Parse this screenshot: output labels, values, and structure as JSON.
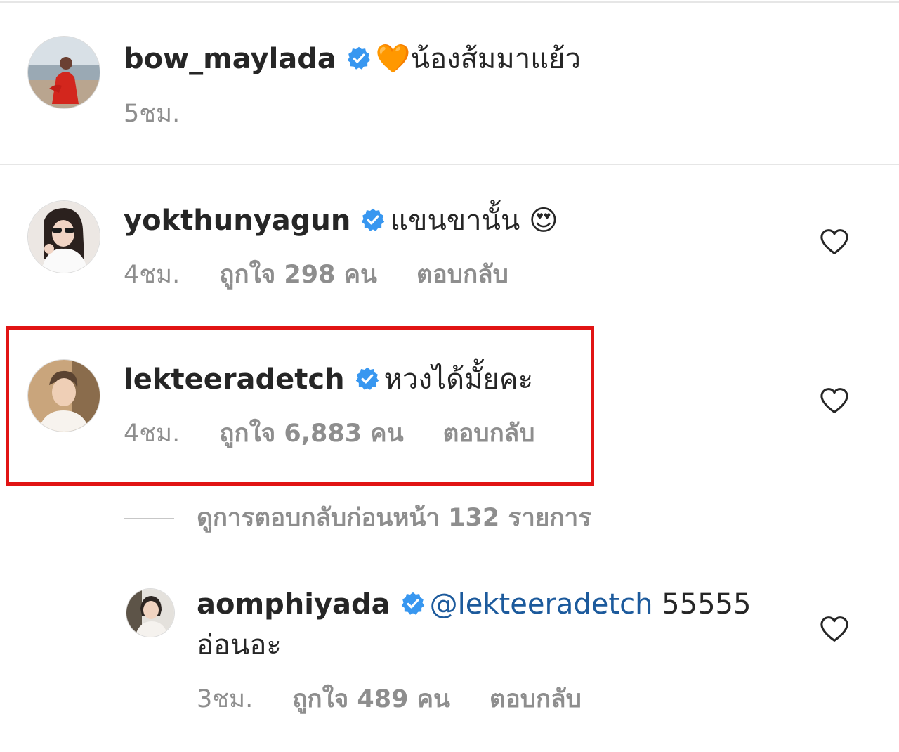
{
  "caption": {
    "username": "bow_maylada",
    "emoji": "🧡",
    "text": "น้องส้มมาแย้ว",
    "time": "5ชม."
  },
  "comments": [
    {
      "username": "yokthunyagun",
      "text": "แขนขานั้น",
      "emoji": "😍",
      "time": "4ชม.",
      "likes": "ถูกใจ 298 คน",
      "reply": "ตอบกลับ"
    },
    {
      "username": "lekteeradetch",
      "text": "หวงได้มั้ยคะ",
      "time": "4ชม.",
      "likes": "ถูกใจ 6,883 คน",
      "reply": "ตอบกลับ"
    }
  ],
  "view_replies": "ดูการตอบกลับก่อนหน้า 132 รายการ",
  "reply_comment": {
    "username": "aomphiyada",
    "mention": "@lekteeradetch",
    "text_line1": "55555",
    "text_line2": "อ่อนอะ",
    "time": "3ชม.",
    "likes": "ถูกใจ 489 คน",
    "reply": "ตอบกลับ"
  },
  "icons": {
    "verified": "verified-badge-icon",
    "heart": "heart-outline-icon"
  },
  "colors": {
    "verified": "#3897f0",
    "mention": "#1c5a9c",
    "highlight": "#e11414",
    "meta": "#8e8e8e"
  }
}
